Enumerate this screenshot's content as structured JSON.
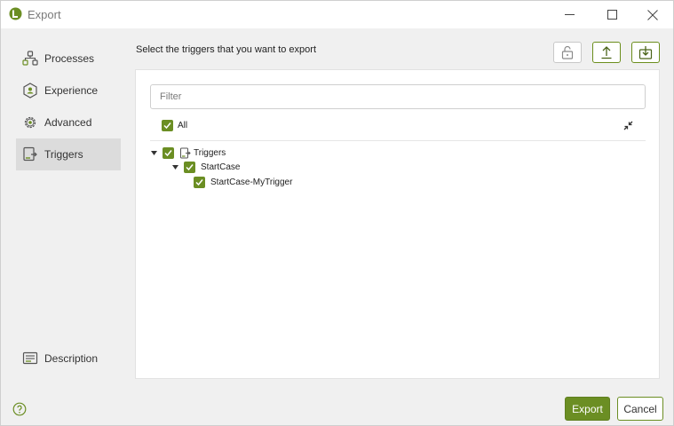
{
  "window": {
    "title": "Export",
    "accent_color": "#6b8e23",
    "controls": [
      "minimize-icon",
      "maximize-icon",
      "close-icon"
    ]
  },
  "sidebar": {
    "items": [
      {
        "label": "Processes",
        "icon": "process-icon",
        "active": false
      },
      {
        "label": "Experience",
        "icon": "experience-icon",
        "active": false
      },
      {
        "label": "Advanced",
        "icon": "gear-icon",
        "active": false
      },
      {
        "label": "Triggers",
        "icon": "trigger-icon",
        "active": true
      }
    ],
    "bottom_item": {
      "label": "Description",
      "icon": "description-icon"
    }
  },
  "main": {
    "instruction": "Select the triggers that you want to export",
    "toolbar": {
      "lock_icon": "lock-icon",
      "upload_icon": "upload-icon",
      "download_icon": "download-icon"
    },
    "filter": {
      "placeholder": "Filter",
      "value": ""
    },
    "all": {
      "label": "All",
      "checked": true
    },
    "tree": [
      {
        "label": "Triggers",
        "checked": true,
        "expanded": true,
        "level": 0,
        "icon": "trigger-icon"
      },
      {
        "label": "StartCase",
        "checked": true,
        "expanded": true,
        "level": 1
      },
      {
        "label": "StartCase-MyTrigger",
        "checked": true,
        "level": 2
      }
    ]
  },
  "footer": {
    "help_icon": "help-icon",
    "export_label": "Export",
    "cancel_label": "Cancel"
  }
}
